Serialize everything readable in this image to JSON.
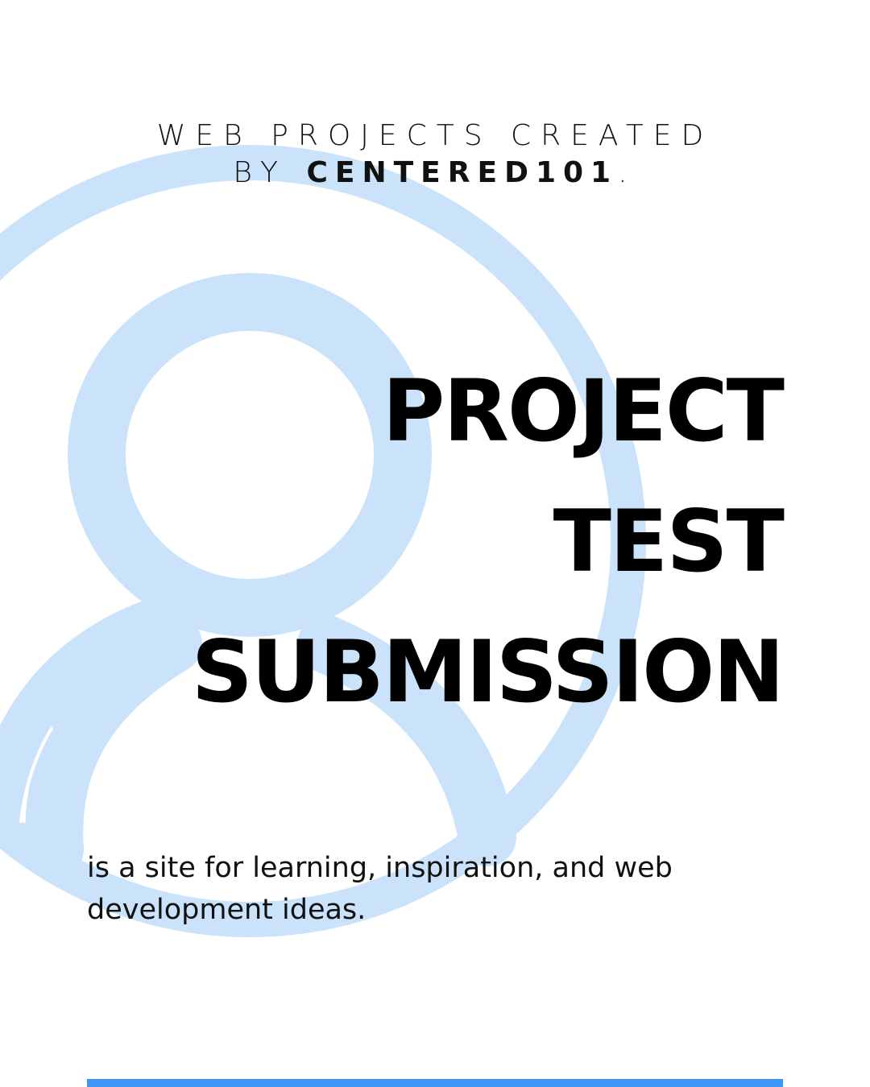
{
  "tagline": {
    "line1": "WEB PROJECTS CREATED",
    "line2_prefix": "BY ",
    "brand": "CENTERED101",
    "line2_suffix": "."
  },
  "headline": {
    "line1": "PROJECT",
    "line2": "TEST",
    "line3": "SUBMISSION"
  },
  "description": "is a site for learning, inspiration, and web development ideas.",
  "colors": {
    "background": "#ffffff",
    "decoration": "#cae3fb",
    "accent_bar": "#3d97f5",
    "text": "#000000"
  },
  "icons": {
    "background_graphic": "user-profile-icon"
  }
}
